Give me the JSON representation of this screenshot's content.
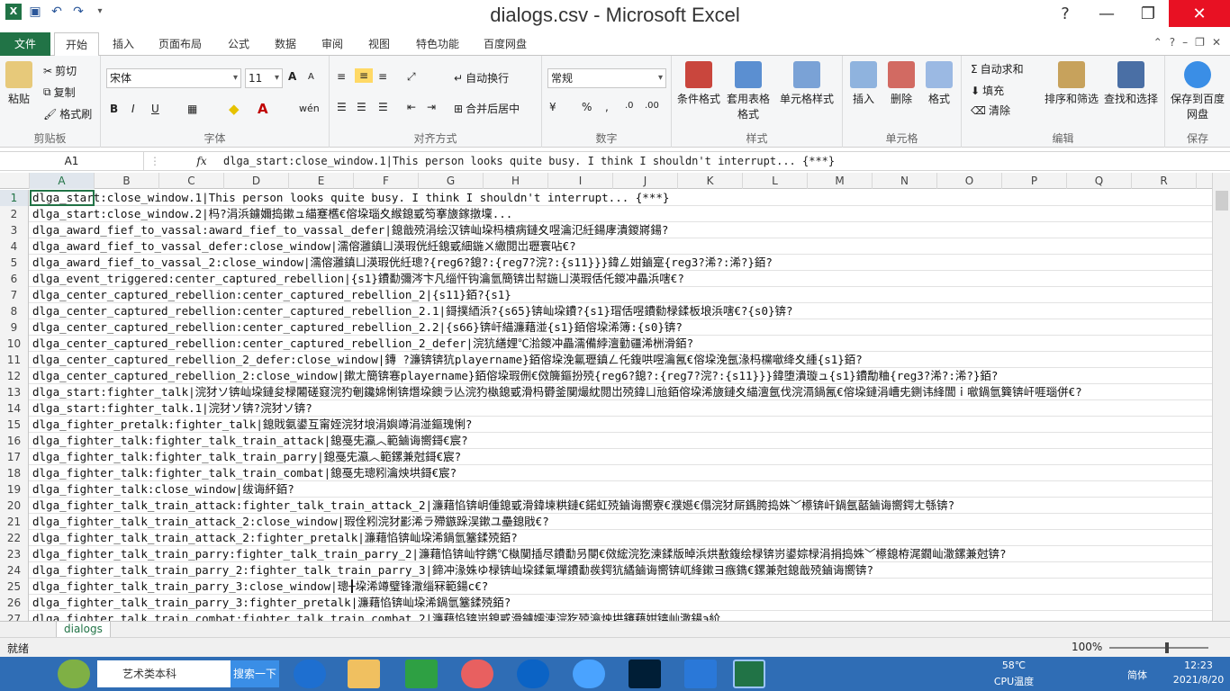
{
  "window": {
    "title": "dialogs.csv - Microsoft Excel"
  },
  "tabs": [
    "文件",
    "开始",
    "插入",
    "页面布局",
    "公式",
    "数据",
    "审阅",
    "视图",
    "特色功能",
    "百度网盘"
  ],
  "ribbon": {
    "clipboard": {
      "paste": "粘贴",
      "cut": "剪切",
      "copy": "复制",
      "format_painter": "格式刷",
      "label": "剪贴板"
    },
    "font": {
      "name": "宋体",
      "size": "11",
      "label": "字体"
    },
    "alignment": {
      "wrap": "自动换行",
      "merge": "合并后居中",
      "label": "对齐方式"
    },
    "number": {
      "format": "常规",
      "label": "数字"
    },
    "styles": {
      "conditional": "条件格式",
      "table": "套用表格格式",
      "cell": "单元格样式",
      "label": "样式"
    },
    "cells": {
      "insert": "插入",
      "delete": "删除",
      "format": "格式",
      "label": "单元格"
    },
    "editing": {
      "autosum": "自动求和",
      "fill": "填充",
      "clear": "清除",
      "sort": "排序和筛选",
      "find": "查找和选择",
      "label": "编辑"
    },
    "save": {
      "button": "保存到百度网盘",
      "label": "保存"
    }
  },
  "formula_bar": {
    "namebox": "A1",
    "fx": "fx",
    "formula": "dlga_start:close_window.1|This person looks quite busy. I think I shouldn't interrupt... {***}"
  },
  "columns": [
    "A",
    "B",
    "C",
    "D",
    "E",
    "F",
    "G",
    "H",
    "I",
    "J",
    "K",
    "L",
    "M",
    "N",
    "O",
    "P",
    "Q",
    "R"
  ],
  "rows": [
    "dlga_start:close_window.1|This person looks quite busy. I think I shouldn't interrupt... {***}",
    "dlga_start:close_window.2|杩?涓浜鐪嬭捣鏉ュ緢蹇欍€傛垜瑙夊緱鎴戜笉搴旇鎵撴壈...",
    "dlga_award_fief_to_vassal:award_fief_to_vassal_defer|鎴戠殑涓绘汉锛屾垜杩樻病鏈夊喅瀹氾紝鍚庨潰鍐嶈鍚?",
    "dlga_award_fief_to_vassal_defer:close_window|濡傛灉鎮ㄩ渶瑕侊紝鎴戜細鍦ㄨ繖閲岀瓑寰呫€?",
    "dlga_award_fief_to_vassal_2:close_window|濡傛灉鎮ㄩ渶瑕侊紝璁?{reg6?鎴?:{reg7?浣?:{s11}}}鍏ㄥ姏鏀寔{reg3?浠?:浠?}銆?",
    "dlga_event_triggered:center_captured_rebellion|{s1}鐨勫彌涔卞凡缁忓钩瀹氫簡锛岀幇鍦ㄩ渶瑕佸仛鍐冲畾浜嗐€?",
    "dlga_center_captured_rebellion:center_captured_rebellion_2|{s11}銆?{s1}",
    "dlga_center_captured_rebellion:center_captured_rebellion_2.1|鎶撲綇浜?{s65}锛屾垜鐨?{s1}瑁佸喅鐨勬椂鍒板埌浜嗐€?{s0}锛?",
    "dlga_center_captured_rebellion:center_captured_rebellion_2.2|{s66}锛屽緢濂藉湴{s1}銆傛垜浠簿:{s0}锛?",
    "dlga_center_captured_rebellion:center_captured_rebellion_2_defer|浣犺繕娌℃湁鍐冲畾濡備綍澶勭疆浠栦滑銆?",
    "dlga_center_captured_rebellion_2_defer:close_window|鏄  ?濂锛锛犺playername}銆傛垜浼氱瓑鎮ㄥ仛鍑哄喅瀹氥€傛垜浼氬湪杩欓噷绛夊緟{s1}銆?",
    "dlga_center_captured_rebellion_2:close_window|鏉ㄤ簡锛寋playername}銆傛垜瑕侀€傚簲鏂扮殑{reg6?鎴?:{reg7?浣?:{s11}}}鍏堕潰璇ュ{s1}鐨勪粬{reg3?浠?:浠?}銆?",
    "dlga_start:fighter_talk|浣犲ソ锛屾垜鏈夋椂闂磋窡浣犳剦鑱婂悧锛熸垜鐭ラ亾浣犳槸鎴戜滑杩欎釜闃熶紞閲岀殑鍏ㄩ兘銆傛垜浠旇鏈夊緢澶氬伐浣滆鍋氥€傛垜鏈涓嶆兂鍘讳綘閭ｉ噷鍋氫簨锛屽啀瑙併€?",
    "dlga_start:fighter_talk.1|浣犲ソ锛?浣犲ソ锛?",
    "dlga_fighter_pretalk:fighter_talk|鎴戝氨鍙互甯姪浣犲埌涓嬩竴涓湴鏂瑰悧?",
    "dlga_fighter_talk:fighter_talk_train_attack|鎴戞兂瀛︿範鏀诲嚮鎶€宸?",
    "dlga_fighter_talk:fighter_talk_train_parry|鎴戞兂瀛︿範鏍兼尅鎶€宸?",
    "dlga_fighter_talk:fighter_talk_train_combat|鎴戞兂璁粌瀹炴垬鎶€宸?",
    "dlga_fighter_talk:close_window|绂诲紑銆?",
    "dlga_fighter_talk_train_attack:fighter_talk_train_attack_2|濂藉惂锛岄偅鎴戜滑鍏堜粠鏈€鍩虹殑鏀诲嚮寮€濮嬨€傝浣犲厛鎷胯捣姝﹀櫒锛屽鍋氬嚭鏀诲嚮鍔ㄤ綔锛?",
    "dlga_fighter_talk_train_attack_2:close_window|瑕佺粌浣犲彲浠ラ殢鏃跺洖鏉ユ壘鎴戙€?",
    "dlga_fighter_talk_train_attack_2:fighter_pretalk|濂藉惂锛屾垜浠鍋氫簺鍒殑銆?",
    "dlga_fighter_talk_train_parry:fighter_talk_train_parry_2|濂藉惂锛屾牸鎸℃槸闃插尽鐨勫叧閿€傚綋浣犵湅鍒版晫浜烘敾鍑绘椂锛岃鍙婃椂涓捐捣姝﹀櫒鎴栫浘鐗屾潵鏍兼尅锛?",
    "dlga_fighter_talk_train_parry_2:fighter_talk_train_parry_3|鍗冲湪姝ゆ椂锛屾垜鍒氭墠鐨勫彂鍔犺繘鏀诲嚮锛屼綘鏉ヨ瘯鐫€鏍兼尅鎴戠殑鏀诲嚮锛?",
    "dlga_fighter_talk_train_parry_3:close_window|璁╂垜浠竴璧锋潵缁冧範鍚с€?",
    "dlga_fighter_talk_train_parry_3:fighter_pretalk|濂藉惂锛屾垜浠鍋氫簺鍒殑銆?",
    "dlga_fighter_talk_train_combat:fighter_talk_train_combat_2|濂藉惂锛岃鎴戜滑鐪嬬湅浣犵殑瀹炴垬鑳藉姏锛屾潵鍚э紒"
  ],
  "sheet": {
    "tab": "dialogs"
  },
  "status": {
    "ready": "就绪",
    "zoom": "100%"
  },
  "taskbar": {
    "search_label": "艺术类本科",
    "search_btn": "搜索一下",
    "temp": "58℃",
    "cpu": "CPU温度",
    "time": "12:23",
    "date": "2021/8/20",
    "lang": "简体"
  }
}
